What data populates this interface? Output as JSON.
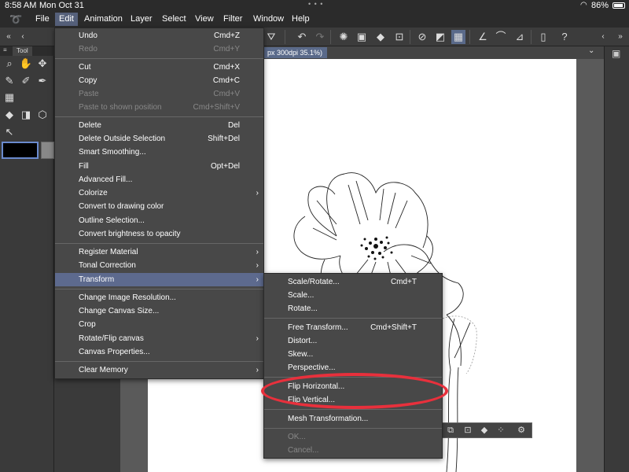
{
  "status_bar": {
    "time": "8:58 AM",
    "date": "Mon Oct 31",
    "dots": "• • •",
    "battery": "86%"
  },
  "menubar": {
    "logo_icon": "clip-studio-logo-icon",
    "items": [
      "File",
      "Edit",
      "Animation",
      "Layer",
      "Select",
      "View",
      "Filter",
      "Window",
      "Help"
    ]
  },
  "left_panel": {
    "tab_label": "Tool"
  },
  "canvas": {
    "tab_label": "px 300dpi 35.1%)"
  },
  "edit_menu": {
    "items": [
      {
        "label": "Undo",
        "shortcut": "Cmd+Z"
      },
      {
        "label": "Redo",
        "shortcut": "Cmd+Y",
        "disabled": true
      },
      {
        "label": "Cut",
        "shortcut": "Cmd+X"
      },
      {
        "label": "Copy",
        "shortcut": "Cmd+C"
      },
      {
        "label": "Paste",
        "shortcut": "Cmd+V",
        "disabled": true
      },
      {
        "label": "Paste to shown position",
        "shortcut": "Cmd+Shift+V",
        "disabled": true
      },
      {
        "label": "Delete",
        "shortcut": "Del"
      },
      {
        "label": "Delete Outside Selection",
        "shortcut": "Shift+Del"
      },
      {
        "label": "Smart Smoothing...",
        "shortcut": ""
      },
      {
        "label": "Fill",
        "shortcut": "Opt+Del"
      },
      {
        "label": "Advanced Fill...",
        "shortcut": ""
      },
      {
        "label": "Colorize",
        "shortcut": "",
        "submenu": true
      },
      {
        "label": "Convert to drawing color",
        "shortcut": ""
      },
      {
        "label": "Outline Selection...",
        "shortcut": ""
      },
      {
        "label": "Convert brightness to opacity",
        "shortcut": ""
      },
      {
        "label": "Register Material",
        "shortcut": "",
        "submenu": true
      },
      {
        "label": "Tonal Correction",
        "shortcut": "",
        "submenu": true
      },
      {
        "label": "Transform",
        "shortcut": "",
        "submenu": true,
        "highlighted": true
      },
      {
        "label": "Change Image Resolution...",
        "shortcut": ""
      },
      {
        "label": "Change Canvas Size...",
        "shortcut": ""
      },
      {
        "label": "Crop",
        "shortcut": ""
      },
      {
        "label": "Rotate/Flip canvas",
        "shortcut": "",
        "submenu": true
      },
      {
        "label": "Canvas Properties...",
        "shortcut": ""
      },
      {
        "label": "Clear Memory",
        "shortcut": "",
        "submenu": true
      }
    ]
  },
  "transform_menu": {
    "items": [
      {
        "label": "Scale/Rotate...",
        "shortcut": "Cmd+T"
      },
      {
        "label": "Scale...",
        "shortcut": ""
      },
      {
        "label": "Rotate...",
        "shortcut": ""
      },
      {
        "label": "Free Transform...",
        "shortcut": "Cmd+Shift+T"
      },
      {
        "label": "Distort...",
        "shortcut": ""
      },
      {
        "label": "Skew...",
        "shortcut": ""
      },
      {
        "label": "Perspective...",
        "shortcut": ""
      },
      {
        "label": "Flip Horizontal...",
        "shortcut": ""
      },
      {
        "label": "Flip Vertical...",
        "shortcut": ""
      },
      {
        "label": "Mesh Transformation...",
        "shortcut": ""
      },
      {
        "label": "OK...",
        "shortcut": "",
        "disabled": true
      },
      {
        "label": "Cancel...",
        "shortcut": "",
        "disabled": true
      }
    ]
  },
  "colors": {
    "accent": "#5d6a8e",
    "annotation": "#e8303c"
  }
}
